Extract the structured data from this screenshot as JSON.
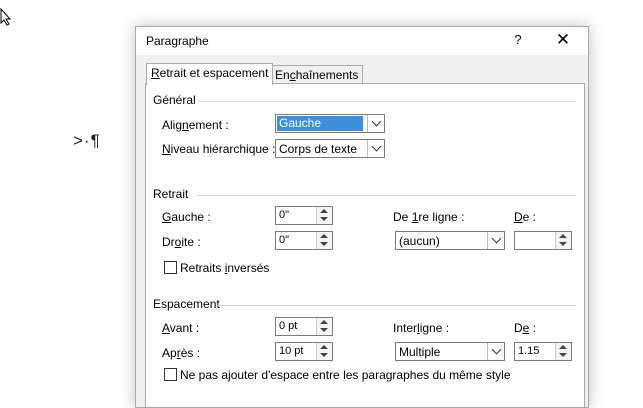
{
  "document": {
    "text_snippet": ">·¶"
  },
  "dialog": {
    "title": "Paragraphe",
    "help_label": "?",
    "close_label": "✕",
    "tabs": [
      {
        "pre": "",
        "u": "R",
        "post": "etrait et espacement"
      },
      {
        "pre": "En",
        "u": "c",
        "post": "haînements"
      }
    ]
  },
  "general": {
    "title": "Général",
    "alignment": {
      "pre": "Alig",
      "u": "n",
      "post": "ement :",
      "value": "Gauche"
    },
    "level": {
      "pre": "",
      "u": "N",
      "post": "iveau hiérarchique :",
      "value": "Corps de texte"
    }
  },
  "retrait": {
    "title": "Retrait",
    "left": {
      "pre": "",
      "u": "G",
      "post": "auche :",
      "value": "0\""
    },
    "right": {
      "pre": "Dr",
      "u": "o",
      "post": "ite :",
      "value": "0\""
    },
    "first_line": {
      "pre": "De ",
      "u": "1",
      "post": "re ligne :",
      "value": "(aucun)"
    },
    "de": {
      "pre": "",
      "u": "D",
      "post": "e :",
      "value": ""
    },
    "mirror": {
      "pre": "Retraits ",
      "u": "i",
      "post": "nversés"
    }
  },
  "espacement": {
    "title": "Espacement",
    "before": {
      "pre": "",
      "u": "A",
      "post": "vant :",
      "value": "0 pt"
    },
    "after": {
      "pre": "Ap",
      "u": "r",
      "post": "ès :",
      "value": "10 pt"
    },
    "line_spacing": {
      "pre": "Inter",
      "u": "l",
      "post": "igne :",
      "value": "Multiple"
    },
    "de": {
      "pre": "D",
      "u": "e",
      "post": " :",
      "value": "1.15"
    },
    "no_space": {
      "pre": "Ne pas a",
      "u": "j",
      "post": "outer d'espace entre les paragraphes du même style"
    }
  }
}
